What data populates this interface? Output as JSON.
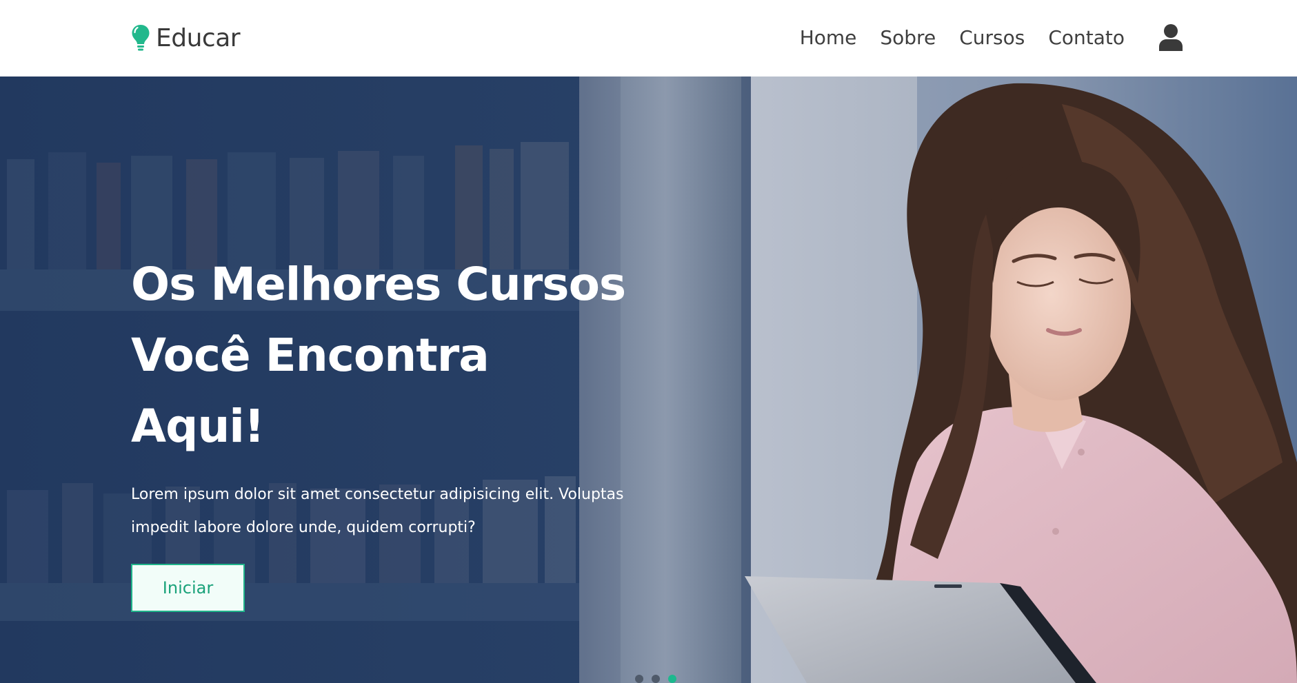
{
  "brand": {
    "name": "Educar",
    "icon": "lightbulb-icon",
    "color": "#22b88c"
  },
  "nav": {
    "items": [
      {
        "label": "Home"
      },
      {
        "label": "Sobre"
      },
      {
        "label": "Cursos"
      },
      {
        "label": "Contato"
      }
    ],
    "user_icon": "user-icon"
  },
  "hero": {
    "title_line1": "Os Melhores Cursos",
    "title_line2": "Você Encontra Aqui!",
    "text": "Lorem ipsum dolor sit amet consectetur adipisicing elit. Voluptas impedit labore dolore unde, quidem corrupti?",
    "button_label": "Iniciar",
    "image": "woman-reading-tablet-photo"
  },
  "carousel": {
    "slide_count": 3,
    "active_index": 2
  },
  "colors": {
    "accent": "#20b48a",
    "hero_overlay": "#2b4468",
    "nav_text": "#3f3f3f"
  }
}
